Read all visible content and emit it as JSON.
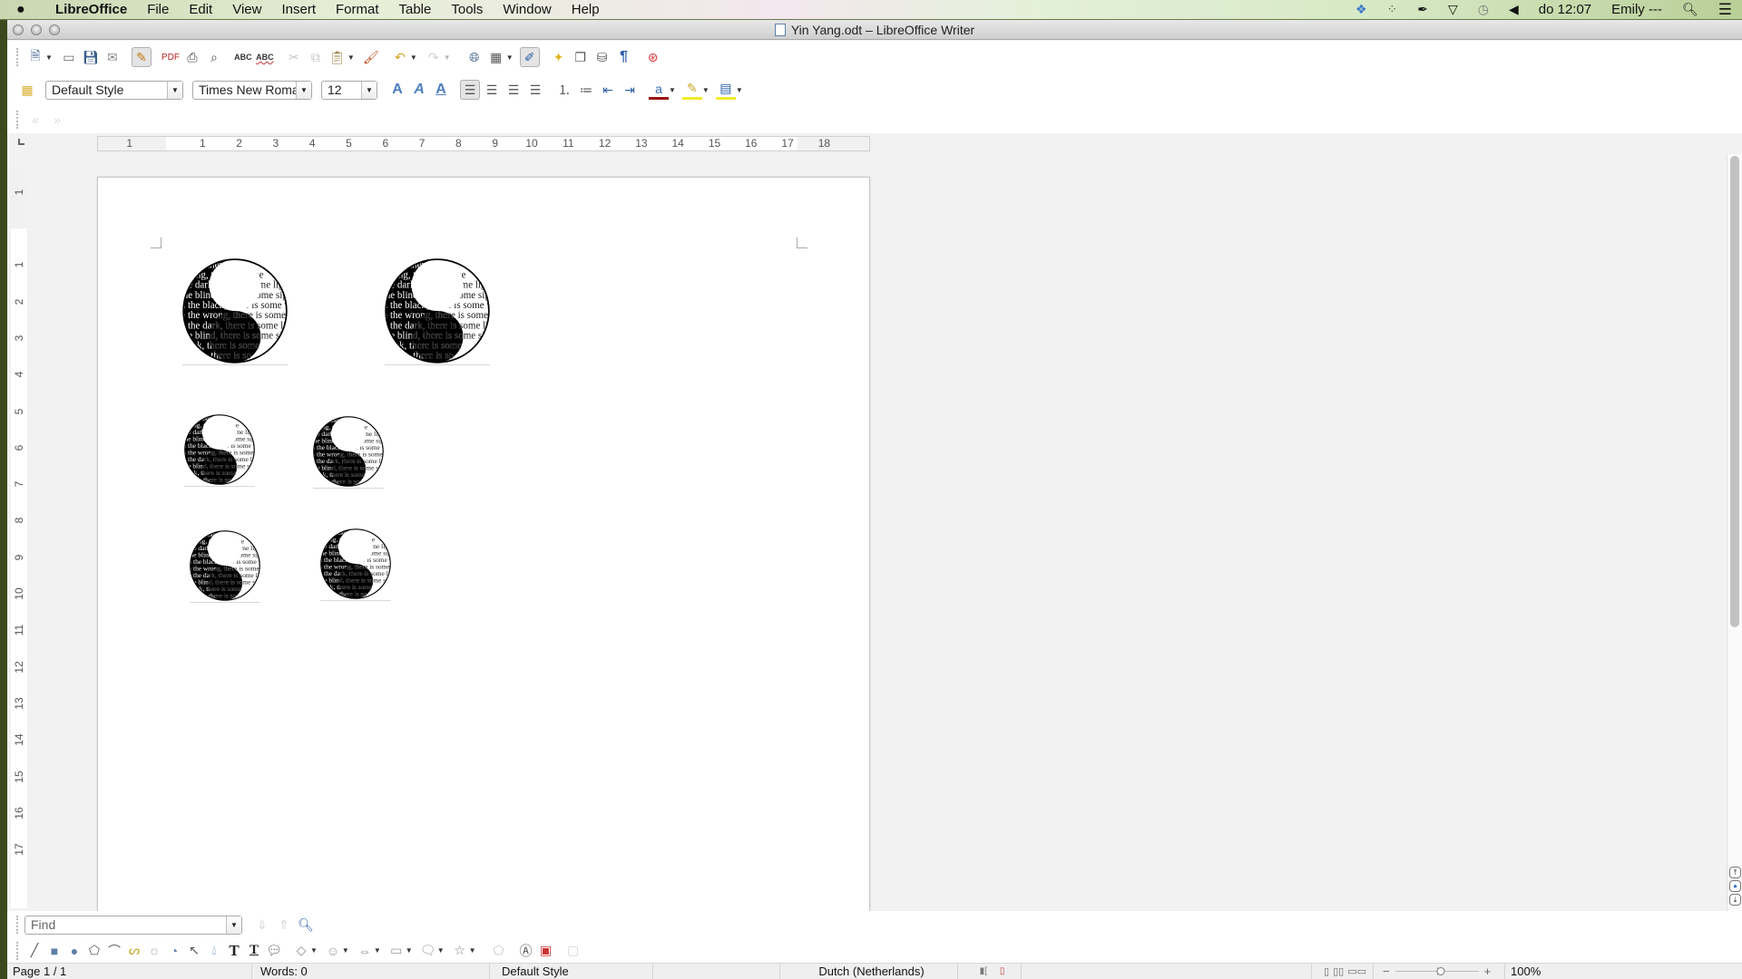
{
  "menubar": {
    "app_name": "LibreOffice",
    "items": [
      "File",
      "Edit",
      "View",
      "Insert",
      "Format",
      "Table",
      "Tools",
      "Window",
      "Help"
    ],
    "tray": {
      "icons": [
        "dropbox-icon",
        "bluetooth-icon",
        "pen-icon",
        "wifi-icon",
        "time-machine-icon",
        "volume-icon"
      ],
      "clock": "do 12:07",
      "user": "Emily ---"
    }
  },
  "window": {
    "title": "Yin Yang.odt – LibreOffice Writer"
  },
  "toolbar_standard": {
    "buttons": [
      "New",
      "Open",
      "Save",
      "E-mail",
      "Edit Mode",
      "Export as PDF",
      "Print",
      "Print Preview",
      "Spelling",
      "Automatic Spell Check",
      "Cut",
      "Copy",
      "Paste",
      "Clone Formatting",
      "Undo",
      "Redo",
      "Hyperlink",
      "Table",
      "Show Draw Functions",
      "Navigator",
      "Gallery",
      "Data Sources",
      "Formatting Marks",
      "Help"
    ]
  },
  "toolbar_formatting": {
    "paragraph_style": "Default Style",
    "font_name": "Times New Roma",
    "font_size": "12",
    "buttons": [
      "Bold",
      "Italic",
      "Underline",
      "Align Left",
      "Center",
      "Align Right",
      "Justify",
      "Numbering",
      "Bullets",
      "Decrease Indent",
      "Increase Indent",
      "Font Color",
      "Highlighting",
      "Background Color"
    ]
  },
  "ruler": {
    "horizontal_labels": [
      "1",
      "1",
      "2",
      "3",
      "4",
      "5",
      "6",
      "7",
      "8",
      "9",
      "10",
      "11",
      "12",
      "13",
      "14",
      "15",
      "16",
      "17",
      "18"
    ],
    "vertical_labels": [
      "1",
      "1",
      "2",
      "3",
      "4",
      "5",
      "6",
      "7",
      "8",
      "9",
      "10",
      "11",
      "12",
      "13",
      "14",
      "15",
      "16",
      "17"
    ]
  },
  "document": {
    "images": [
      {
        "name": "yin-yang-1",
        "text_lines": [
          "black, there is",
          "wrong, there is some",
          "the dark, there is some lig",
          "the blind, there is some sig",
          "n the black, there is some wh",
          "n the wrong, there is some rig",
          "n the dark, there is some ligh",
          "the blind, there is some si",
          "black, there is some",
          "wrong, there is so"
        ]
      },
      {
        "name": "yin-yang-2"
      },
      {
        "name": "yin-yang-3"
      },
      {
        "name": "yin-yang-4"
      },
      {
        "name": "yin-yang-5"
      },
      {
        "name": "yin-yang-6"
      }
    ]
  },
  "findbar": {
    "placeholder": "Find"
  },
  "drawbar": {
    "buttons": [
      "Line",
      "Rectangle",
      "Ellipse",
      "Polygon",
      "Curve",
      "Freeform Line",
      "Arc",
      "Ellipse Pie",
      "Select",
      "Fill",
      "Text",
      "Vertical Text",
      "Callouts",
      "Basic Shapes",
      "Symbol Shapes",
      "Block Arrows",
      "Flowchart",
      "Callout Shapes",
      "Stars",
      "Points",
      "Fontwork",
      "Insert Image",
      "Extrusion"
    ]
  },
  "statusbar": {
    "page": "Page 1 / 1",
    "words": "Words: 0",
    "page_style": "Default Style",
    "language": "Dutch (Netherlands)",
    "zoom": "100%",
    "zoom_value_percent": 100
  }
}
